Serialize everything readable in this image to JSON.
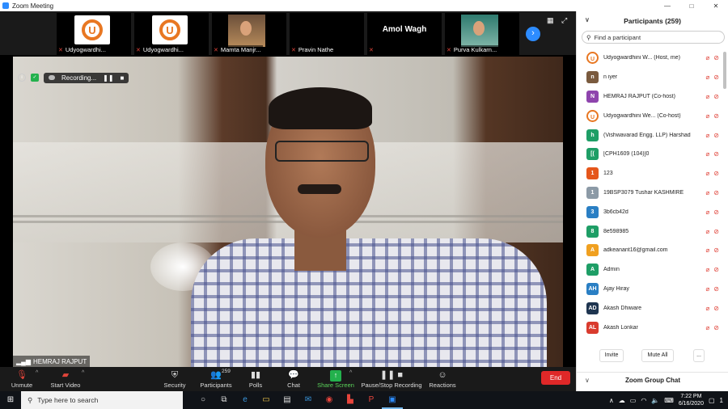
{
  "window": {
    "title": "Zoom Meeting",
    "controls": [
      "—",
      "□",
      "✕"
    ]
  },
  "thumbnails": [
    {
      "name": "Udyogwardhi...",
      "kind": "logo"
    },
    {
      "name": "Udyogwardhi...",
      "kind": "logo"
    },
    {
      "name": "Mamta Manjr...",
      "kind": "photo"
    },
    {
      "name": "Pravin Nathe",
      "kind": "blank"
    },
    {
      "name": "",
      "kind": "name",
      "display": "Amol Wagh"
    },
    {
      "name": "Purva Kulkarn...",
      "kind": "photo-girl"
    }
  ],
  "stage": {
    "recording_label": "Recording...",
    "active_speaker": "HEMRAJ RAJPUT",
    "logo_letter": "U"
  },
  "toolbar": {
    "unmute": "Unmute",
    "start_video": "Start Video",
    "security": "Security",
    "participants": "Participants",
    "participant_count": "259",
    "polls": "Polls",
    "chat": "Chat",
    "share_screen": "Share Screen",
    "record": "Pause/Stop Recording",
    "reactions": "Reactions",
    "end": "End"
  },
  "panel": {
    "title": "Participants (259)",
    "search_placeholder": "Find a participant",
    "participants": [
      {
        "name": "Udyogwardhini W... (Host, me)",
        "avatar": "U",
        "color": "#e87722",
        "type": "logo"
      },
      {
        "name": "n iyer",
        "avatar": "n",
        "color": "#7a5a3e",
        "type": "photo"
      },
      {
        "name": "HEMRAJ RAJPUT (Co-host)",
        "avatar": "N",
        "color": "#8e44ad",
        "type": "letter"
      },
      {
        "name": "Udyogwardhini We... (Co-host)",
        "avatar": "U",
        "color": "#e87722",
        "type": "logo"
      },
      {
        "name": "(Vishwavarad Engg. LLP) Harshad",
        "avatar": "h",
        "color": "#1e9e66",
        "type": "letter"
      },
      {
        "name": "[CPH1609 (104)]0",
        "avatar": "[(",
        "color": "#1e9e66",
        "type": "letter"
      },
      {
        "name": "123",
        "avatar": "1",
        "color": "#e5561b",
        "type": "letter"
      },
      {
        "name": "19BSP3079 Tushar KASHMIRE",
        "avatar": "1",
        "color": "#8c9aa6",
        "type": "photo"
      },
      {
        "name": "3b6cb42d",
        "avatar": "3",
        "color": "#2a7fc4",
        "type": "letter"
      },
      {
        "name": "8e598985",
        "avatar": "8",
        "color": "#1e9e66",
        "type": "letter"
      },
      {
        "name": "adkeanant16@gmail.com",
        "avatar": "A",
        "color": "#f0a020",
        "type": "letter"
      },
      {
        "name": "Admin",
        "avatar": "A",
        "color": "#1e9e66",
        "type": "letter"
      },
      {
        "name": "Ajay Hiray",
        "avatar": "AH",
        "color": "#2a7fc4",
        "type": "letter"
      },
      {
        "name": "Akash Dhiware",
        "avatar": "AD",
        "color": "#1f3550",
        "type": "letter"
      },
      {
        "name": "Akash Lonkar",
        "avatar": "AL",
        "color": "#d93b2e",
        "type": "letter"
      }
    ],
    "invite": "Invite",
    "mute_all": "Mute All",
    "more": "...",
    "group_chat": "Zoom Group Chat"
  },
  "taskbar": {
    "search_placeholder": "Type here to search",
    "time": "7:22 PM",
    "date": "6/16/2020",
    "notification_count": "1"
  },
  "colors": {
    "accent": "#2d8cff",
    "end": "#e02828",
    "muted": "#e0443a",
    "share": "#23b14d"
  }
}
